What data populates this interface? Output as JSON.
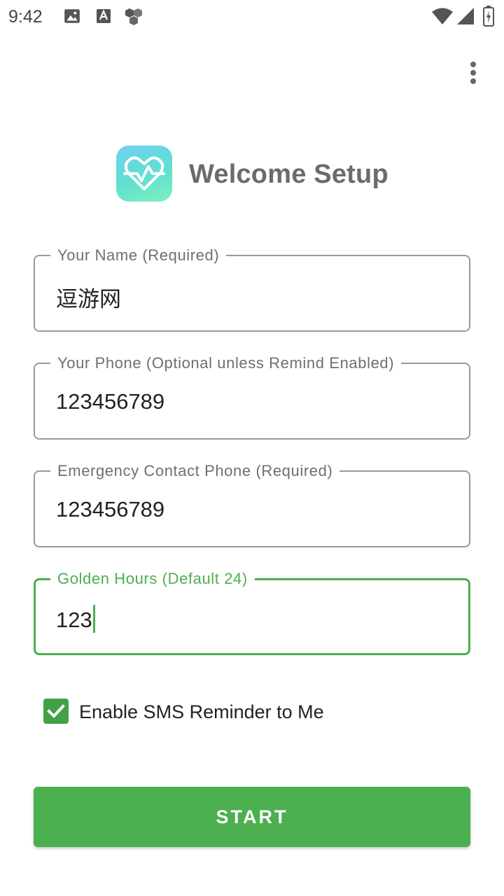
{
  "status_bar": {
    "time": "9:42",
    "icons": [
      "image-icon",
      "a-icon",
      "cube-icon",
      "wifi-icon",
      "signal-icon",
      "battery-icon"
    ]
  },
  "header": {
    "title": "Welcome Setup",
    "logo_icon": "heart-pulse-icon"
  },
  "form": {
    "fields": [
      {
        "label": "Your Name (Required)",
        "value": "逗游网"
      },
      {
        "label": "Your Phone (Optional unless Remind Enabled)",
        "value": "123456789"
      },
      {
        "label": "Emergency Contact Phone (Required)",
        "value": "123456789"
      },
      {
        "label": "Golden Hours (Default 24)",
        "value": "123",
        "focused": true
      }
    ],
    "sms_reminder": {
      "label": "Enable SMS Reminder to Me",
      "checked": true
    },
    "start_label": "START"
  },
  "colors": {
    "accent": "#4caf50",
    "title": "#6b6b6b",
    "border": "#9a9a9a"
  }
}
